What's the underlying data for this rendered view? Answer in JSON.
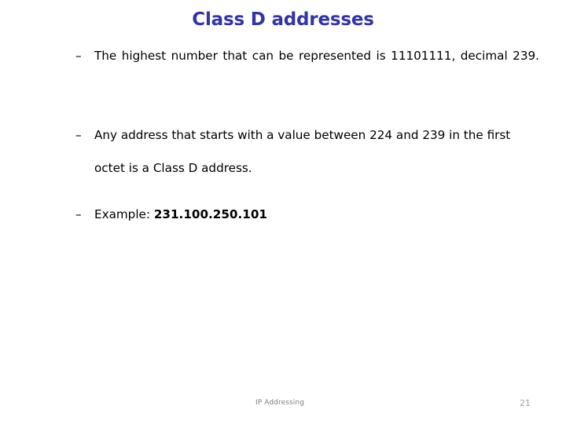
{
  "slide": {
    "title": "Class D addresses",
    "title_color": "#3333AA",
    "background_color": "#FFFFFF",
    "text_color": "#000000",
    "bullet_marker": "–",
    "bullets": [
      {
        "marker": "–",
        "text": "The highest number that can be represented is 11101111, decimal 239.",
        "justified": true
      },
      {
        "marker": "–",
        "text": "Any address that starts with a value between 224 and 239 in the first octet is a Class D address.",
        "justified": false
      },
      {
        "marker": "–",
        "label": "Example: ",
        "value": "231.100.250.101",
        "justified": false
      }
    ]
  },
  "footer": {
    "note": "IP Addressing",
    "note_color": "#808080",
    "page_number": "21",
    "page_number_color": "#A0A0A0"
  }
}
